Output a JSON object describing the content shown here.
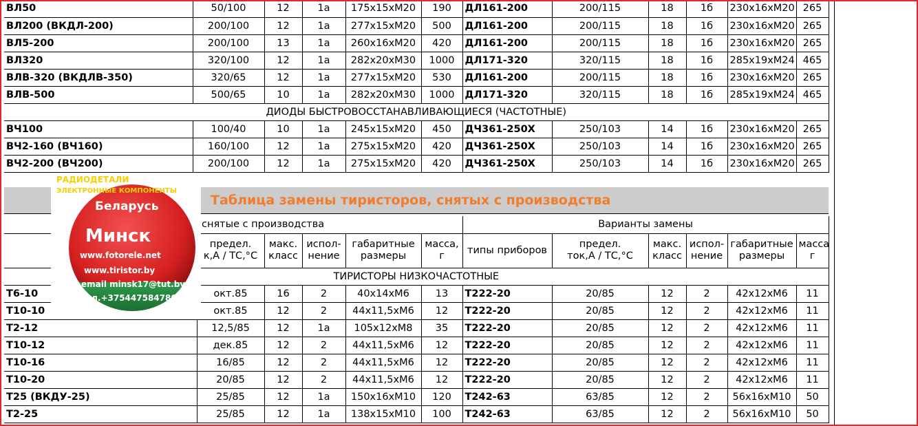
{
  "top_rows": [
    [
      "ВЛ50",
      "50/100",
      "12",
      "1а",
      "175х15хМ20",
      "190",
      "ДЛ161-200",
      "200/115",
      "18",
      "1б",
      "230х16хМ20",
      "265"
    ],
    [
      "ВЛ200 (ВКДЛ-200)",
      "200/100",
      "12",
      "1а",
      "277х15хМ20",
      "500",
      "ДЛ161-200",
      "200/115",
      "18",
      "1б",
      "230х16хМ20",
      "265"
    ],
    [
      "ВЛ5-200",
      "200/100",
      "13",
      "1а",
      "260х16хМ20",
      "420",
      "ДЛ161-200",
      "200/115",
      "18",
      "1б",
      "230х16хМ20",
      "265"
    ],
    [
      "ВЛ320",
      "320/100",
      "12",
      "1а",
      "282х20хМ30",
      "1000",
      "ДЛ171-320",
      "320/115",
      "18",
      "1б",
      "285х19хМ24",
      "465"
    ],
    [
      "ВЛВ-320 (ВКДЛВ-350)",
      "320/65",
      "12",
      "1а",
      "277х15хМ20",
      "530",
      "ДЛ161-200",
      "200/115",
      "18",
      "1б",
      "230х16хМ20",
      "265"
    ],
    [
      "ВЛВ-500",
      "500/65",
      "10",
      "1а",
      "282х20хМ30",
      "1000",
      "ДЛ171-320",
      "320/115",
      "18",
      "1б",
      "285х19хМ24",
      "465"
    ]
  ],
  "section_fast_diodes": "ДИОДЫ БЫСТРОВОССТАНАВЛИВАЮЩИЕСЯ (ЧАСТОТНЫЕ)",
  "fast_rows": [
    [
      "ВЧ100",
      "100/40",
      "10",
      "1а",
      "245х15хМ20",
      "450",
      "ДЧ361-250Х",
      "250/103",
      "14",
      "1б",
      "230х16хМ20",
      "265"
    ],
    [
      "ВЧ2-160 (ВЧ160)",
      "160/100",
      "12",
      "1а",
      "275х15хМ20",
      "420",
      "ДЧ361-250Х",
      "250/103",
      "14",
      "1б",
      "230х16хМ20",
      "265"
    ],
    [
      "ВЧ2-200 (ВЧ200)",
      "200/100",
      "12",
      "1а",
      "275х15хМ20",
      "420",
      "ДЧ361-250Х",
      "250/103",
      "14",
      "1б",
      "230х16хМ20",
      "265"
    ]
  ],
  "banner_title": "Таблица замены тиристоров, снятых с производства",
  "header": {
    "group_removed": "снятые с производства",
    "group_replacement": "Варианты замены",
    "cols_left": [
      [
        "предел.",
        "к,А / ТС,°С"
      ],
      [
        "макс.",
        "класс"
      ],
      [
        "испол-",
        "нение"
      ],
      [
        "габаритные",
        "размеры"
      ],
      [
        "масса,",
        "г"
      ]
    ],
    "replacement_type": "типы приборов",
    "cols_right": [
      [
        "предел.",
        "ток,А / ТС,°С"
      ],
      [
        "макс.",
        "класс"
      ],
      [
        "испол-",
        "нение"
      ],
      [
        "габаритные",
        "размеры"
      ],
      [
        "масса,",
        "г"
      ]
    ]
  },
  "section_low_freq": "ТИРИСТОРЫ НИЗКОЧАСТОТНЫЕ",
  "thyristor_rows": [
    [
      "Т6-10",
      "окт.85",
      "16",
      "2",
      "40х14хМ6",
      "13",
      "Т222-20",
      "20/85",
      "12",
      "2",
      "42х12хМ6",
      "11"
    ],
    [
      "Т10-10",
      "окт.85",
      "12",
      "2",
      "44х11,5хМ6",
      "12",
      "Т222-20",
      "20/85",
      "12",
      "2",
      "42х12хМ6",
      "11"
    ],
    [
      "Т2-12",
      "12,5/85",
      "12",
      "1а",
      "105х12хМ8",
      "35",
      "Т222-20",
      "20/85",
      "12",
      "2",
      "42х12хМ6",
      "11"
    ],
    [
      "Т10-12",
      "дек.85",
      "12",
      "2",
      "44х11,5хМ6",
      "12",
      "Т222-20",
      "20/85",
      "12",
      "2",
      "42х12хМ6",
      "11"
    ],
    [
      "Т10-16",
      "16/85",
      "12",
      "2",
      "44х11,5хМ6",
      "12",
      "Т222-20",
      "20/85",
      "12",
      "2",
      "42х12хМ6",
      "11"
    ],
    [
      "Т10-20",
      "20/85",
      "12",
      "2",
      "44х11,5хМ6",
      "12",
      "Т222-20",
      "20/85",
      "12",
      "2",
      "42х12хМ6",
      "11"
    ],
    [
      "Т25 (ВКДУ-25)",
      "25/85",
      "12",
      "1а",
      "150х16хМ10",
      "120",
      "Т242-63",
      "63/85",
      "12",
      "2",
      "56х16хМ10",
      "50"
    ],
    [
      "Т2-25",
      "25/85",
      "12",
      "1а",
      "138х15хМ10",
      "100",
      "Т242-63",
      "63/85",
      "12",
      "2",
      "56х16хМ10",
      "50"
    ]
  ],
  "sticker": {
    "line1": "РАДИОДЕТАЛИ",
    "line2": "ЭЛЕКТРОННЫЕ КОМПОНЕНТЫ",
    "country": "Беларусь",
    "city": "Минск",
    "site1": "www.fotorele.net",
    "site2": "www.tiristor.by",
    "email": "email  minsk17@tut.by",
    "phone": "тел.+375447584780"
  },
  "colors": {
    "frame": "#e0272b",
    "banner_bg": "#cccccc",
    "banner_title": "#f07c2e",
    "sticker_red": "#d62020",
    "sticker_green": "#1f7a3a"
  }
}
